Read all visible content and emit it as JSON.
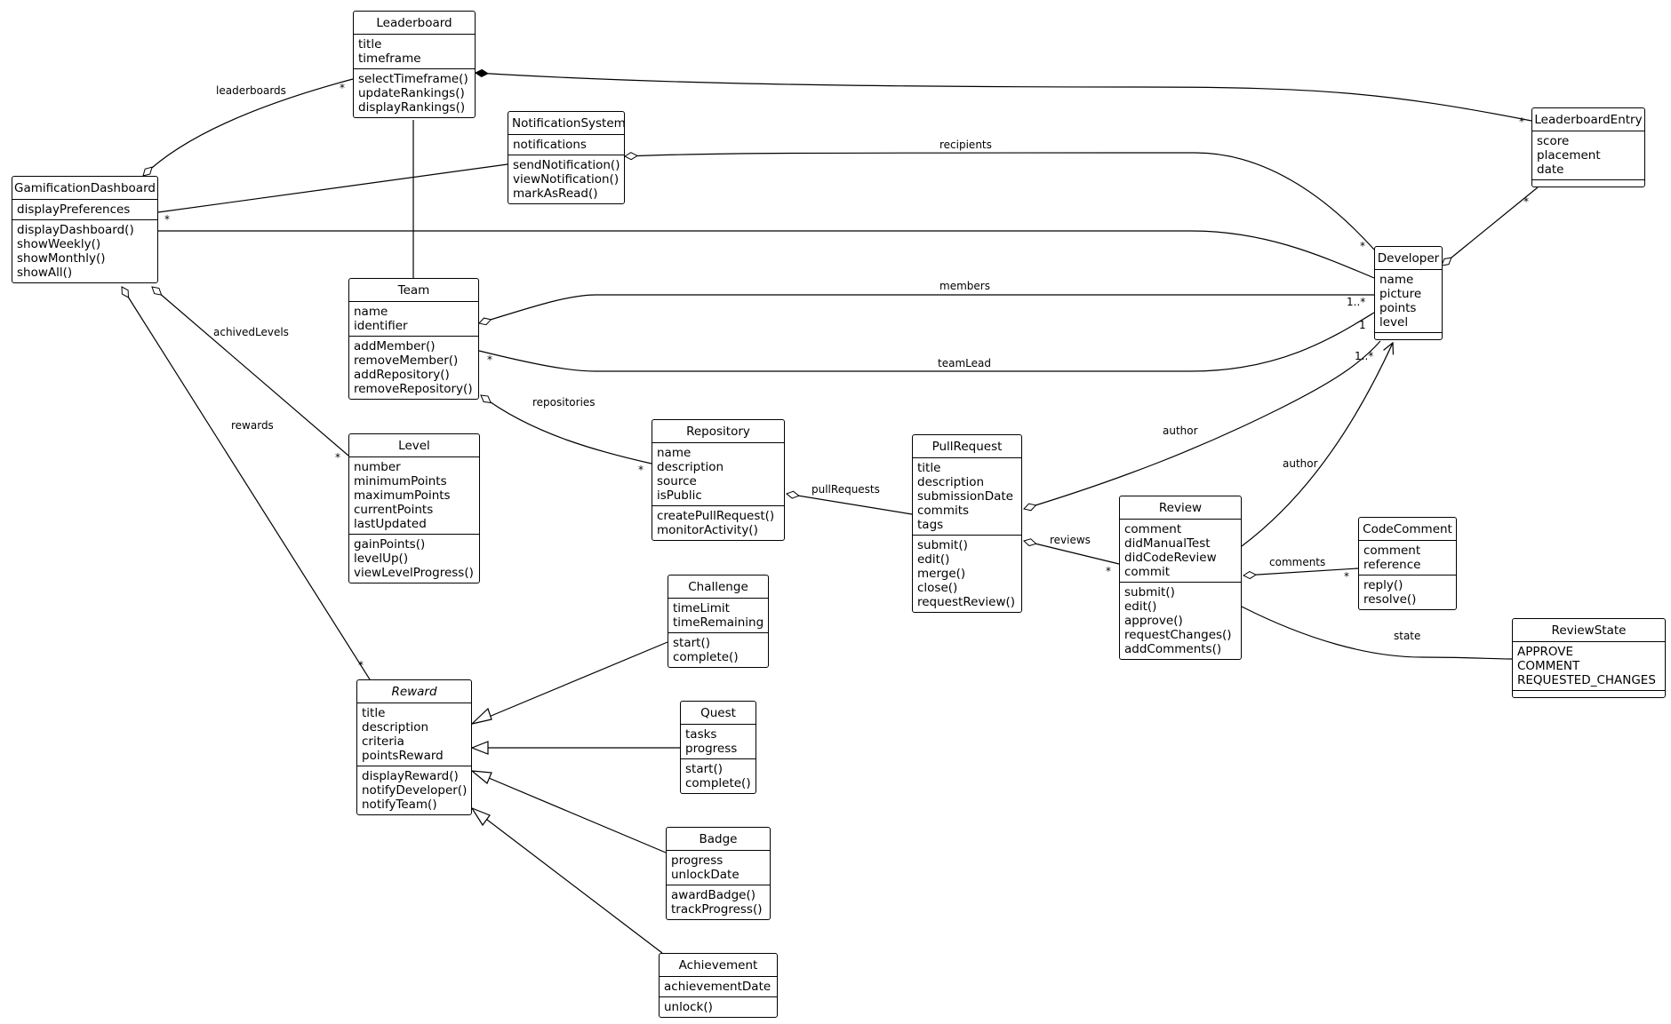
{
  "diagram": {
    "type": "UML class diagram",
    "classes": {
      "leaderboard": {
        "name": "Leaderboard",
        "attributes": [
          "title",
          "timeframe"
        ],
        "methods": [
          "selectTimeframe()",
          "updateRankings()",
          "displayRankings()"
        ]
      },
      "notificationSystem": {
        "name": "NotificationSystem",
        "attributes": [
          "notifications"
        ],
        "methods": [
          "sendNotification()",
          "viewNotification()",
          "markAsRead()"
        ]
      },
      "leaderboardEntry": {
        "name": "LeaderboardEntry",
        "attributes": [
          "score",
          "placement",
          "date"
        ],
        "methods": []
      },
      "gamificationDashboard": {
        "name": "GamificationDashboard",
        "attributes": [
          "displayPreferences"
        ],
        "methods": [
          "displayDashboard()",
          "showWeekly()",
          "showMonthly()",
          "showAll()"
        ]
      },
      "developer": {
        "name": "Developer",
        "attributes": [
          "name",
          "picture",
          "points",
          "level"
        ],
        "methods": []
      },
      "team": {
        "name": "Team",
        "attributes": [
          "name",
          "identifier"
        ],
        "methods": [
          "addMember()",
          "removeMember()",
          "addRepository()",
          "removeRepository()"
        ]
      },
      "level": {
        "name": "Level",
        "attributes": [
          "number",
          "minimumPoints",
          "maximumPoints",
          "currentPoints",
          "lastUpdated"
        ],
        "methods": [
          "gainPoints()",
          "levelUp()",
          "viewLevelProgress()"
        ]
      },
      "repository": {
        "name": "Repository",
        "attributes": [
          "name",
          "description",
          "source",
          "isPublic"
        ],
        "methods": [
          "createPullRequest()",
          "monitorActivity()"
        ]
      },
      "pullRequest": {
        "name": "PullRequest",
        "attributes": [
          "title",
          "description",
          "submissionDate",
          "commits",
          "tags"
        ],
        "methods": [
          "submit()",
          "edit()",
          "merge()",
          "close()",
          "requestReview()"
        ]
      },
      "review": {
        "name": "Review",
        "attributes": [
          "comment",
          "didManualTest",
          "didCodeReview",
          "commit"
        ],
        "methods": [
          "submit()",
          "edit()",
          "approve()",
          "requestChanges()",
          "addComments()"
        ]
      },
      "codeComment": {
        "name": "CodeComment",
        "attributes": [
          "comment",
          "reference"
        ],
        "methods": [
          "reply()",
          "resolve()"
        ]
      },
      "reviewState": {
        "name": "ReviewState",
        "attributes": [
          "APPROVE",
          "COMMENT",
          "REQUESTED_CHANGES"
        ],
        "methods": []
      },
      "challenge": {
        "name": "Challenge",
        "attributes": [
          "timeLimit",
          "timeRemaining"
        ],
        "methods": [
          "start()",
          "complete()"
        ]
      },
      "reward": {
        "name": "Reward",
        "abstract": true,
        "attributes": [
          "title",
          "description",
          "criteria",
          "pointsReward"
        ],
        "methods": [
          "displayReward()",
          "notifyDeveloper()",
          "notifyTeam()"
        ]
      },
      "quest": {
        "name": "Quest",
        "attributes": [
          "tasks",
          "progress"
        ],
        "methods": [
          "start()",
          "complete()"
        ]
      },
      "badge": {
        "name": "Badge",
        "attributes": [
          "progress",
          "unlockDate"
        ],
        "methods": [
          "awardBadge()",
          "trackProgress()"
        ]
      },
      "achievement": {
        "name": "Achievement",
        "attributes": [
          "achievementDate"
        ],
        "methods": [
          "unlock()"
        ]
      }
    },
    "relations": [
      {
        "id": "leaderboards",
        "from": "GamificationDashboard",
        "to": "Leaderboard",
        "kind": "aggregation",
        "label": "leaderboards",
        "target_mult": "*"
      },
      {
        "id": "lb-entries",
        "from": "Leaderboard",
        "to": "LeaderboardEntry",
        "kind": "composition",
        "label": "",
        "target_mult": "*"
      },
      {
        "id": "lb-team",
        "from": "Leaderboard",
        "to": "Team",
        "kind": "association",
        "label": ""
      },
      {
        "id": "dash-notif",
        "from": "NotificationSystem",
        "to": "GamificationDashboard",
        "kind": "association",
        "label": "",
        "target_mult": "*"
      },
      {
        "id": "recipients",
        "from": "NotificationSystem",
        "to": "Developer",
        "kind": "aggregation",
        "label": "recipients",
        "target_mult": "*"
      },
      {
        "id": "dash-dev",
        "from": "GamificationDashboard",
        "to": "Developer",
        "kind": "association",
        "label": ""
      },
      {
        "id": "dev-entries",
        "from": "Developer",
        "to": "LeaderboardEntry",
        "kind": "aggregation",
        "label": "",
        "target_mult": "*"
      },
      {
        "id": "members",
        "from": "Team",
        "to": "Developer",
        "kind": "aggregation",
        "label": "members",
        "target_mult": "1..*"
      },
      {
        "id": "teamLead",
        "from": "Team",
        "to": "Developer",
        "kind": "association",
        "label": "teamLead",
        "source_mult": "*",
        "target_mult": "1"
      },
      {
        "id": "achivedLevels",
        "from": "GamificationDashboard",
        "to": "Level",
        "kind": "aggregation",
        "label": "achivedLevels",
        "target_mult": "*"
      },
      {
        "id": "rewards",
        "from": "GamificationDashboard",
        "to": "Reward",
        "kind": "aggregation",
        "label": "rewards",
        "target_mult": "*"
      },
      {
        "id": "repositories",
        "from": "Team",
        "to": "Repository",
        "kind": "aggregation",
        "label": "repositories",
        "target_mult": "*"
      },
      {
        "id": "pullRequests",
        "from": "Repository",
        "to": "PullRequest",
        "kind": "aggregation",
        "label": "pullRequests"
      },
      {
        "id": "pr-author",
        "from": "PullRequest",
        "to": "Developer",
        "kind": "aggregation",
        "label": "author",
        "target_mult": "1..*"
      },
      {
        "id": "reviews",
        "from": "PullRequest",
        "to": "Review",
        "kind": "aggregation",
        "label": "reviews",
        "target_mult": "*"
      },
      {
        "id": "review-author",
        "from": "Review",
        "to": "Developer",
        "kind": "directed association",
        "label": "author"
      },
      {
        "id": "comments",
        "from": "Review",
        "to": "CodeComment",
        "kind": "aggregation",
        "label": "comments",
        "target_mult": "*"
      },
      {
        "id": "state",
        "from": "Review",
        "to": "ReviewState",
        "kind": "association",
        "label": "state"
      },
      {
        "id": "gen-challenge",
        "from": "Challenge",
        "to": "Reward",
        "kind": "generalization"
      },
      {
        "id": "gen-quest",
        "from": "Quest",
        "to": "Reward",
        "kind": "generalization"
      },
      {
        "id": "gen-badge",
        "from": "Badge",
        "to": "Reward",
        "kind": "generalization"
      },
      {
        "id": "gen-achievement",
        "from": "Achievement",
        "to": "Reward",
        "kind": "generalization"
      }
    ],
    "labels": {
      "leaderboards": "leaderboards",
      "recipients": "recipients",
      "members": "members",
      "teamLead": "teamLead",
      "achivedLevels": "achivedLevels",
      "rewards": "rewards",
      "repositories": "repositories",
      "pullRequests": "pullRequests",
      "prAuthor": "author",
      "reviewAuthor": "author",
      "reviews": "reviews",
      "comments": "comments",
      "state": "state"
    },
    "multiplicities": {
      "star": "*",
      "oneMany": "1..*",
      "one": "1"
    }
  }
}
